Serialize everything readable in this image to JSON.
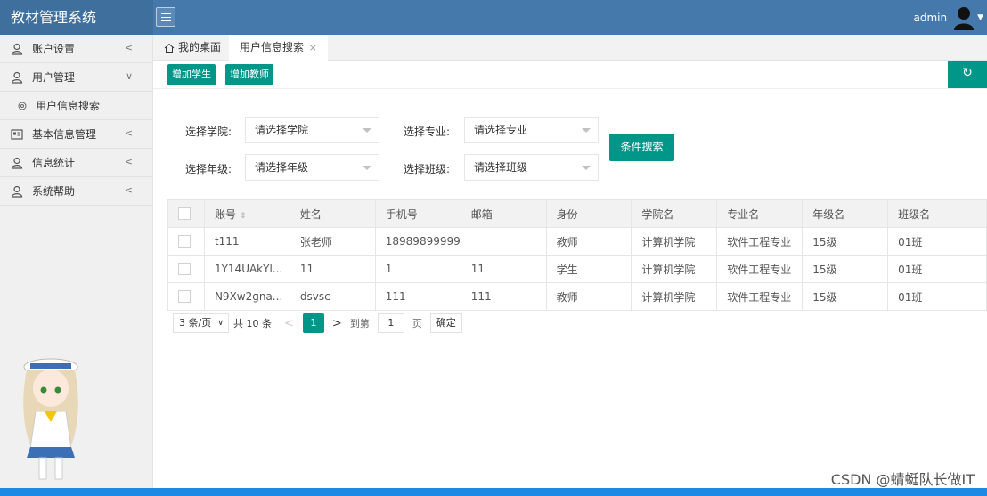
{
  "app": {
    "title": "教材管理系统",
    "user": "admin"
  },
  "sidebar": {
    "items": [
      {
        "label": "账户设置",
        "icon": "user-icon",
        "arrow": "<"
      },
      {
        "label": "用户管理",
        "icon": "user-icon",
        "arrow": "∨",
        "expanded": true
      },
      {
        "label": "用户信息搜索",
        "icon": "settings-circle-icon",
        "sub": true
      },
      {
        "label": "基本信息管理",
        "icon": "id-card-icon",
        "arrow": "<"
      },
      {
        "label": "信息统计",
        "icon": "user-icon",
        "arrow": "<"
      },
      {
        "label": "系统帮助",
        "icon": "user-icon",
        "arrow": "<"
      }
    ]
  },
  "tabs": {
    "home": "我的桌面",
    "active": "用户信息搜索",
    "close": "×"
  },
  "toolbar": {
    "add_student": "增加学生",
    "add_teacher": "增加教师",
    "refresh": "↻"
  },
  "filters": {
    "college_label": "选择学院:",
    "college_value": "请选择学院",
    "major_label": "选择专业:",
    "major_value": "请选择专业",
    "grade_label": "选择年级:",
    "grade_value": "请选择年级",
    "class_label": "选择班级:",
    "class_value": "请选择班级",
    "search_button": "条件搜索"
  },
  "table": {
    "headers": [
      "账号",
      "姓名",
      "手机号",
      "邮箱",
      "身份",
      "学院名",
      "专业名",
      "年级名",
      "班级名"
    ],
    "sort_icon": "⇕",
    "rows": [
      [
        "t111",
        "张老师",
        "18989899999",
        "",
        "教师",
        "计算机学院",
        "软件工程专业",
        "15级",
        "01班"
      ],
      [
        "1Y14UAkYl...",
        "11",
        "1",
        "11",
        "学生",
        "计算机学院",
        "软件工程专业",
        "15级",
        "01班"
      ],
      [
        "N9Xw2gna...",
        "dsvsc",
        "111",
        "111",
        "教师",
        "计算机学院",
        "软件工程专业",
        "15级",
        "01班"
      ]
    ]
  },
  "pagination": {
    "page_size": "3 条/页",
    "total": "共 10 条",
    "prev": "<",
    "current": "1",
    "next": ">",
    "goto": "到第",
    "input_value": "1",
    "page_unit": "页",
    "confirm": "确定"
  },
  "watermark": "CSDN @蜻蜓队长做IT",
  "colors": {
    "header": "#4679ab",
    "accent": "#009688",
    "bottom_bar": "#1e88e5"
  }
}
